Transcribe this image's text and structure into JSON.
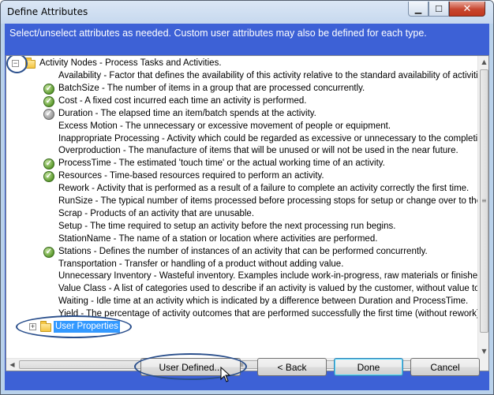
{
  "window": {
    "title": "Define Attributes",
    "minimize_glyph": "▁",
    "maximize_glyph": "☐",
    "close_glyph": "✕"
  },
  "instructions": "Select/unselect attributes as needed.  Custom user attributes may also be defined for each type.",
  "tree": {
    "root": {
      "label": "Activity Nodes - Process Tasks and Activities.",
      "expander": "−",
      "expanded": true
    },
    "items": [
      {
        "label": "Availability - Factor that defines the availability of this activity relative to the standard availability of activities.",
        "state": "none"
      },
      {
        "label": "BatchSize - The number of items in a group that are processed concurrently.",
        "state": "checked"
      },
      {
        "label": "Cost - A fixed cost incurred each time an activity is performed.",
        "state": "checked"
      },
      {
        "label": "Duration - The elapsed time an item/batch spends at the activity.",
        "state": "checked-gray"
      },
      {
        "label": "Excess Motion - The unnecessary or excessive movement of people or equipment.",
        "state": "none"
      },
      {
        "label": "Inappropriate Processing - Activity which could be regarded as excessive or unnecessary to the completion of a p",
        "state": "none"
      },
      {
        "label": "Overproduction - The manufacture of items that will be unused or will not be used in the near future.",
        "state": "none"
      },
      {
        "label": "ProcessTime - The estimated 'touch time' or the actual working time of an activity.",
        "state": "checked"
      },
      {
        "label": "Resources - Time-based resources required to perform an activity.",
        "state": "checked"
      },
      {
        "label": "Rework - Activity that is performed as a result of a failure to complete an activity correctly the first time.",
        "state": "none"
      },
      {
        "label": "RunSize - The typical number of items processed before processing stops for setup or change over to the next ite",
        "state": "none"
      },
      {
        "label": "Scrap - Products of an activity that are unusable.",
        "state": "none"
      },
      {
        "label": "Setup - The time required to setup an activity before the next processing run begins.",
        "state": "none"
      },
      {
        "label": "StationName - The name of a station or location where activities are performed.",
        "state": "none"
      },
      {
        "label": "Stations - Defines the number of instances of an activity that can be performed concurrently.",
        "state": "checked"
      },
      {
        "label": "Transportation - Transfer or handling of a product without adding value.",
        "state": "none"
      },
      {
        "label": "Unnecessary Inventory - Wasteful inventory.  Examples include work-in-progress, raw materials or finished goods t",
        "state": "none"
      },
      {
        "label": "Value Class - A list of categories used to describe if an activity is valued by the customer, without value to the cust",
        "state": "none"
      },
      {
        "label": "Waiting - Idle time at an activity which is indicated by a difference between Duration and ProcessTime.",
        "state": "none"
      },
      {
        "label": "Yield - The percentage of activity outcomes that are performed successfully the first time (without rework).",
        "state": "none"
      }
    ],
    "user_properties": {
      "label": "User Properties",
      "expander": "+",
      "selected": true
    }
  },
  "scrollbars": {
    "up_arrow": "▲",
    "down_arrow": "▼",
    "left_arrow": "◀",
    "right_arrow": "▶",
    "grip": "≡"
  },
  "buttons": {
    "user_defined": "User Defined...",
    "back": "< Back",
    "done": "Done",
    "cancel": "Cancel"
  },
  "check_glyph": "✓"
}
